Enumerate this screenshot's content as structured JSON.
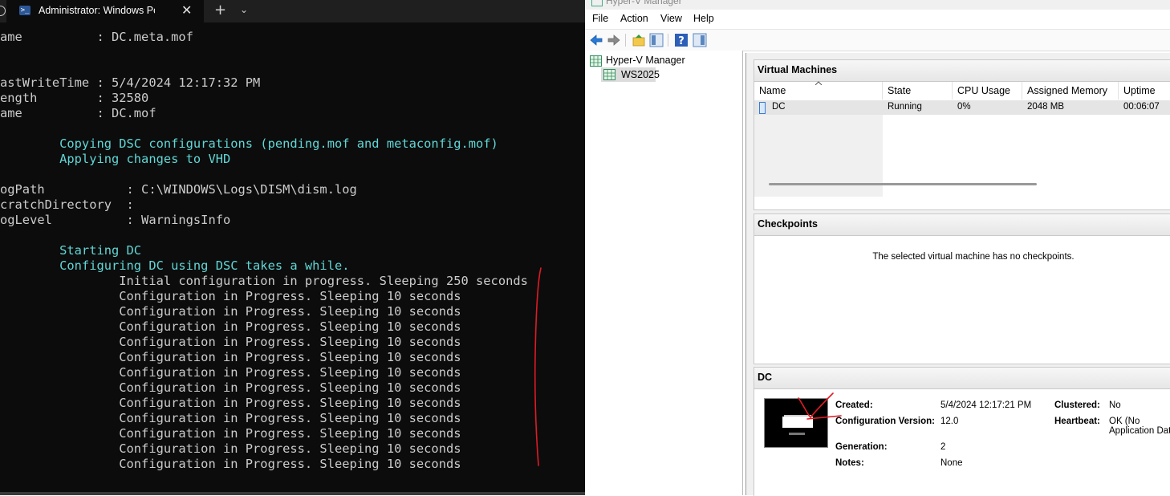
{
  "terminal": {
    "tab_title": "Administrator: Windows PowerShell",
    "new_tab": "+",
    "close_glyph": "✕",
    "dropdown_glyph": "⌄",
    "prompt_glyph": ">_",
    "lines": [
      {
        "text": "ame          : DC.meta.mof",
        "style": "normal"
      },
      {
        "text": "",
        "style": "normal"
      },
      {
        "text": "",
        "style": "normal"
      },
      {
        "text": "astWriteTime : 5/4/2024 12:17:32 PM",
        "style": "normal"
      },
      {
        "text": "ength        : 32580",
        "style": "normal"
      },
      {
        "text": "ame          : DC.mof",
        "style": "normal"
      },
      {
        "text": "",
        "style": "normal"
      },
      {
        "text": "        Copying DSC configurations (pending.mof and metaconfig.mof)",
        "style": "info"
      },
      {
        "text": "        Applying changes to VHD",
        "style": "info"
      },
      {
        "text": "",
        "style": "normal"
      },
      {
        "text": "ogPath           : C:\\WINDOWS\\Logs\\DISM\\dism.log",
        "style": "normal"
      },
      {
        "text": "cratchDirectory  :",
        "style": "normal"
      },
      {
        "text": "ogLevel          : WarningsInfo",
        "style": "normal"
      },
      {
        "text": "",
        "style": "normal"
      },
      {
        "text": "        Starting DC",
        "style": "info"
      },
      {
        "text": "        Configuring DC using DSC takes a while.",
        "style": "info"
      },
      {
        "text": "                Initial configuration in progress. Sleeping 250 seconds",
        "style": "normal"
      },
      {
        "text": "                Configuration in Progress. Sleeping 10 seconds",
        "style": "normal"
      },
      {
        "text": "                Configuration in Progress. Sleeping 10 seconds",
        "style": "normal"
      },
      {
        "text": "                Configuration in Progress. Sleeping 10 seconds",
        "style": "normal"
      },
      {
        "text": "                Configuration in Progress. Sleeping 10 seconds",
        "style": "normal"
      },
      {
        "text": "                Configuration in Progress. Sleeping 10 seconds",
        "style": "normal"
      },
      {
        "text": "                Configuration in Progress. Sleeping 10 seconds",
        "style": "normal"
      },
      {
        "text": "                Configuration in Progress. Sleeping 10 seconds",
        "style": "normal"
      },
      {
        "text": "                Configuration in Progress. Sleeping 10 seconds",
        "style": "normal"
      },
      {
        "text": "                Configuration in Progress. Sleeping 10 seconds",
        "style": "normal"
      },
      {
        "text": "                Configuration in Progress. Sleeping 10 seconds",
        "style": "normal"
      },
      {
        "text": "                Configuration in Progress. Sleeping 10 seconds",
        "style": "normal"
      },
      {
        "text": "                Configuration in Progress. Sleeping 10 seconds",
        "style": "normal"
      }
    ]
  },
  "hyperv": {
    "window_title": "Hyper-V Manager",
    "menu": [
      "File",
      "Action",
      "View",
      "Help"
    ],
    "tree": {
      "root": "Hyper-V Manager",
      "server": "WS2025"
    },
    "vm_panel": {
      "title": "Virtual Machines",
      "columns": [
        "Name",
        "State",
        "CPU Usage",
        "Assigned Memory",
        "Uptime"
      ],
      "rows": [
        {
          "name": "DC",
          "state": "Running",
          "cpu": "0%",
          "memory": "2048 MB",
          "uptime": "00:06:07"
        }
      ]
    },
    "checkpoints": {
      "title": "Checkpoints",
      "message": "The selected virtual machine has no checkpoints."
    },
    "details": {
      "title": "DC",
      "created_label": "Created:",
      "created_value": "5/4/2024 12:17:21 PM",
      "config_label": "Configuration Version:",
      "config_value": "12.0",
      "generation_label": "Generation:",
      "generation_value": "2",
      "notes_label": "Notes:",
      "notes_value": "None",
      "clustered_label": "Clustered:",
      "clustered_value": "No",
      "heartbeat_label": "Heartbeat:",
      "heartbeat_value_line1": "OK (No",
      "heartbeat_value_line2": "Application Data"
    }
  },
  "colors": {
    "terminal_bg": "#0c0c0c",
    "terminal_text": "#cccccc",
    "terminal_info": "#61d6d6",
    "annotation_red": "#e01b24",
    "selection_gray": "#e5e5e5"
  }
}
